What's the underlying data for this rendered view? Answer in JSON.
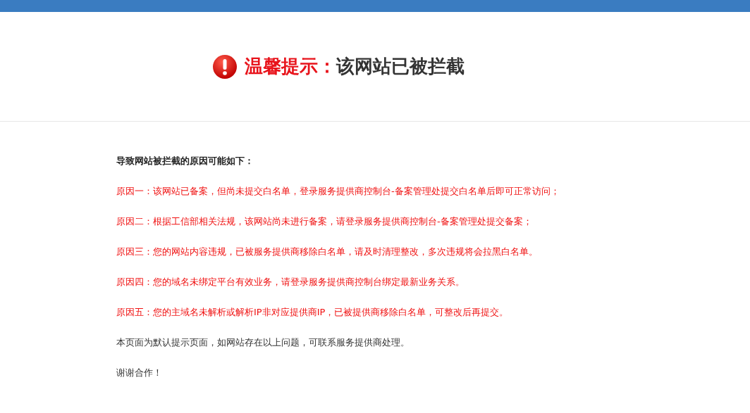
{
  "title": {
    "label": "温馨提示：",
    "text": "该网站已被拦截"
  },
  "paragraphs": [
    {
      "kind": "heading",
      "text": "导致网站被拦截的原因可能如下："
    },
    {
      "kind": "reason",
      "text": "原因一：该网站已备案，但尚未提交白名单，登录服务提供商控制台-备案管理处提交白名单后即可正常访问；"
    },
    {
      "kind": "reason",
      "text": "原因二：根据工信部相关法规，该网站尚未进行备案，请登录服务提供商控制台-备案管理处提交备案；"
    },
    {
      "kind": "reason",
      "text": "原因三：您的网站内容违规，已被服务提供商移除白名单，请及时清理整改，多次违规将会拉黑白名单。"
    },
    {
      "kind": "reason",
      "text": "原因四：您的域名未绑定平台有效业务，请登录服务提供商控制台绑定最新业务关系。"
    },
    {
      "kind": "reason",
      "text": "原因五：您的主域名未解析或解析IP非对应提供商IP，已被提供商移除白名单，可整改后再提交。"
    },
    {
      "kind": "note",
      "text": "本页面为默认提示页面，如网站存在以上问题，可联系服务提供商处理。"
    },
    {
      "kind": "note",
      "text": "谢谢合作！"
    }
  ]
}
